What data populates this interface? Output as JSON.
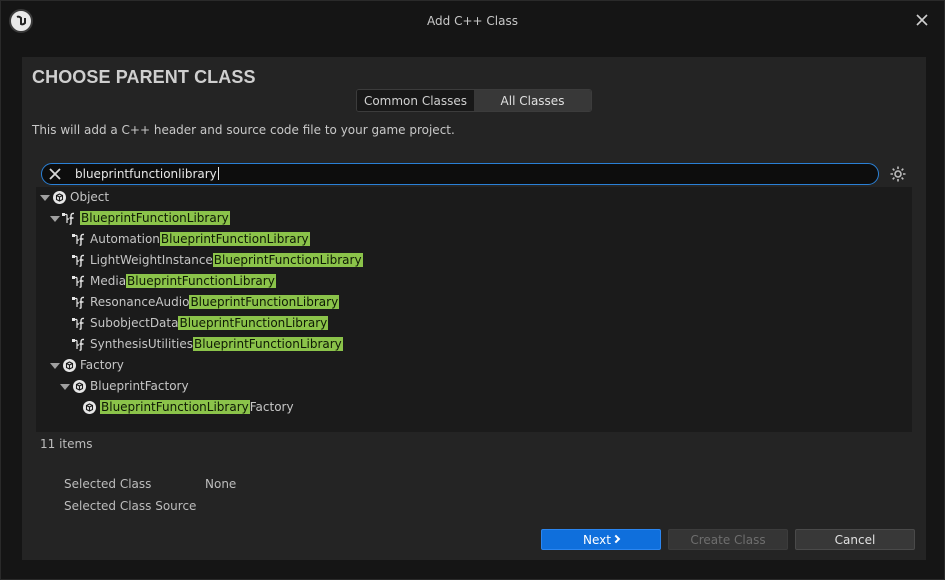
{
  "window": {
    "title": "Add C++ Class"
  },
  "panel": {
    "heading": "CHOOSE PARENT CLASS",
    "tabs": [
      "Common Classes",
      "All Classes"
    ],
    "active_tab": "All Classes",
    "description": "This will add a C++ header and source code file to your game project."
  },
  "search": {
    "value": "blueprintfunctionlibrary"
  },
  "tree": {
    "rows": [
      {
        "prefix": "Object",
        "match": "",
        "suffix": "",
        "icon": "object-icon",
        "expanded": true
      },
      {
        "prefix": "",
        "match": "BlueprintFunctionLibrary",
        "suffix": "",
        "icon": "function-library-icon",
        "expanded": true
      },
      {
        "prefix": "Automation",
        "match": "BlueprintFunctionLibrary",
        "suffix": "",
        "icon": "function-library-icon"
      },
      {
        "prefix": "LightWeightInstance",
        "match": "BlueprintFunctionLibrary",
        "suffix": "",
        "icon": "function-library-icon"
      },
      {
        "prefix": "Media",
        "match": "BlueprintFunctionLibrary",
        "suffix": "",
        "icon": "function-library-icon"
      },
      {
        "prefix": "ResonanceAudio",
        "match": "BlueprintFunctionLibrary",
        "suffix": "",
        "icon": "function-library-icon"
      },
      {
        "prefix": "SubobjectData",
        "match": "BlueprintFunctionLibrary",
        "suffix": "",
        "icon": "function-library-icon"
      },
      {
        "prefix": "SynthesisUtilities",
        "match": "BlueprintFunctionLibrary",
        "suffix": "",
        "icon": "function-library-icon"
      },
      {
        "prefix": "Factory",
        "match": "",
        "suffix": "",
        "icon": "object-icon",
        "expanded": true
      },
      {
        "prefix": "BlueprintFactory",
        "match": "",
        "suffix": "",
        "icon": "object-icon",
        "expanded": true
      },
      {
        "prefix": "",
        "match": "BlueprintFunctionLibrary",
        "suffix": "Factory",
        "icon": "object-icon"
      }
    ]
  },
  "item_count": "11 items",
  "selection": {
    "class_label": "Selected Class",
    "class_value": "None",
    "source_label": "Selected Class Source",
    "source_value": ""
  },
  "buttons": {
    "next": "Next",
    "create": "Create Class",
    "cancel": "Cancel"
  },
  "colors": {
    "highlight": "#8bc34a",
    "accent": "#0f6fdc",
    "search_border": "#2a80d6"
  }
}
